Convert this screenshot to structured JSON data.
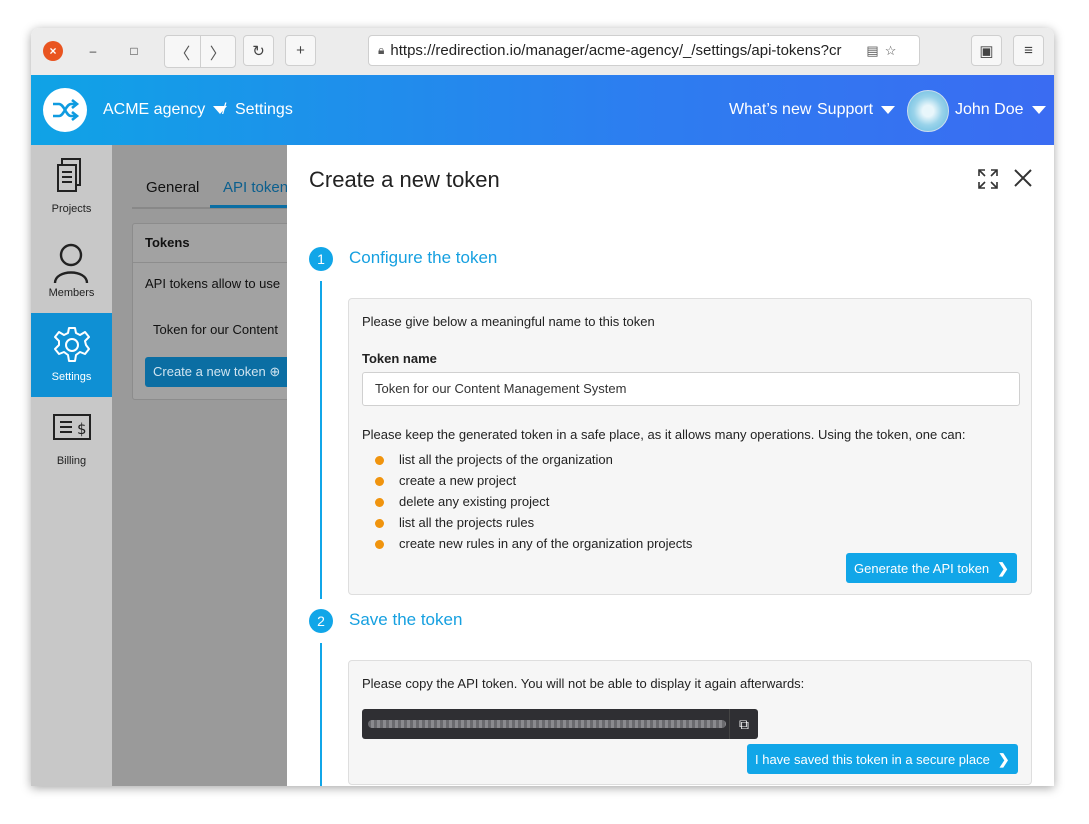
{
  "browser": {
    "url": "https://redirection.io/manager/acme-agency/_/settings/api-tokens?cr",
    "close_symbol": "×",
    "min_symbol": "–",
    "max_symbol": "□",
    "back_symbol": "〈",
    "forward_symbol": "〉",
    "reload_symbol": "↻",
    "newtab_symbol": "+",
    "reader_symbol": "▤",
    "star_symbol": "☆",
    "menu_symbol": "≡"
  },
  "header": {
    "org_name": "ACME agency",
    "separator": "/",
    "section": "Settings",
    "whats_new": "What’s new",
    "support": "Support",
    "user_name": "John Doe"
  },
  "sidebar": {
    "items": [
      {
        "label": "Projects",
        "icon": "projects-icon"
      },
      {
        "label": "Members",
        "icon": "members-icon"
      },
      {
        "label": "Settings",
        "icon": "settings-icon"
      },
      {
        "label": "Billing",
        "icon": "billing-icon"
      }
    ],
    "active": "Settings"
  },
  "page": {
    "tabs": [
      "General",
      "API tokens"
    ],
    "card_title": "Tokens",
    "card_text": "API tokens allow to use",
    "card_row": "Token for our Content",
    "create_button": "Create a new token"
  },
  "modal": {
    "title": "Create a new token",
    "step1": {
      "number": "1",
      "label": "Configure the token",
      "intro": "Please give below a meaningful name to this token",
      "field_label": "Token name",
      "field_value": "Token for our Content Management System",
      "warning": "Please keep the generated token in a safe place, as it allows many operations. Using the token, one can:",
      "bullets": [
        "list all the projects of the organization",
        "create a new project",
        "delete any existing project",
        "list all the projects rules",
        "create new rules in any of the organization projects"
      ],
      "button": "Generate the API token"
    },
    "step2": {
      "number": "2",
      "label": "Save the token",
      "intro": "Please copy the API token. You will not be able to display it again afterwards:",
      "button": "I have saved this token in a secure place"
    }
  },
  "colors": {
    "accent": "#11a6e8",
    "header_start": "#0fa3e6",
    "header_end": "#3a6cf2",
    "bullet": "#f0940e",
    "sidebar_active": "#0f90d4"
  }
}
